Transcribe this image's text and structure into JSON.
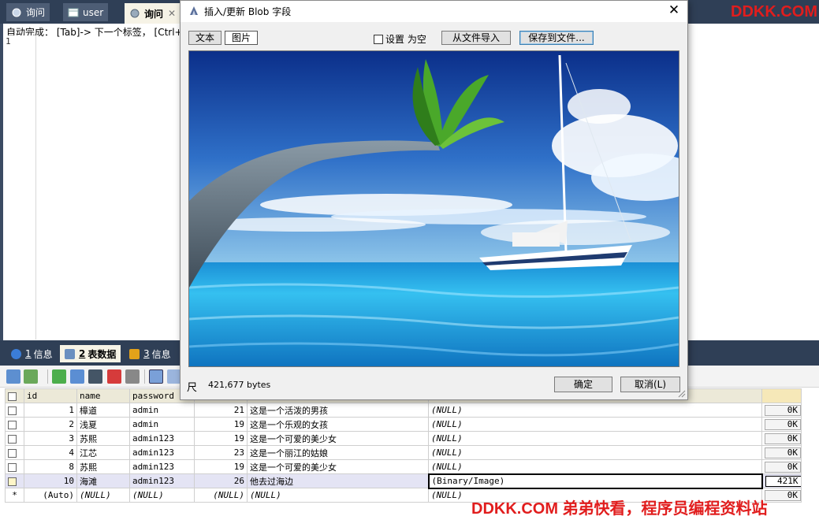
{
  "tabs": [
    {
      "label": "询问",
      "icon": "query-icon"
    },
    {
      "label": "user",
      "icon": "table-icon"
    },
    {
      "label": "询问",
      "icon": "query-icon",
      "close": "✕"
    }
  ],
  "watermark_top": "DDKK.COM",
  "watermark_bottom": "DDKK.COM 弟弟快看，程序员编程资料站",
  "editor": {
    "hint": "自动完成： [Tab]-> 下一个标签， [Ctrl+",
    "line_number": "1"
  },
  "result_tabs": [
    {
      "num": "1",
      "label": "信息"
    },
    {
      "num": "2",
      "label": "表数据"
    },
    {
      "num": "3",
      "label": "信息"
    }
  ],
  "grid": {
    "columns": [
      "id",
      "name",
      "password"
    ],
    "rows": [
      {
        "id": "1",
        "name": "樟道",
        "password": "admin",
        "age": "21",
        "desc": "这是一个活泼的男孩",
        "blob": "(NULL)",
        "size": "0K"
      },
      {
        "id": "2",
        "name": "浅夏",
        "password": "admin",
        "age": "19",
        "desc": "这是一个乐观的女孩",
        "blob": "(NULL)",
        "size": "0K"
      },
      {
        "id": "3",
        "name": "苏熙",
        "password": "admin123",
        "age": "19",
        "desc": "这是一个可爱的美少女",
        "blob": "(NULL)",
        "size": "0K"
      },
      {
        "id": "4",
        "name": "江芯",
        "password": "admin123",
        "age": "23",
        "desc": "这是一个丽江的姑娘",
        "blob": "(NULL)",
        "size": "0K"
      },
      {
        "id": "8",
        "name": "苏熙",
        "password": "admin123",
        "age": "19",
        "desc": "这是一个可爱的美少女",
        "blob": "(NULL)",
        "size": "0K"
      },
      {
        "id": "10",
        "name": "海滩",
        "password": "admin123",
        "age": "26",
        "desc": "他去过海边",
        "blob": "(Binary/Image)",
        "size": "421K"
      }
    ],
    "new_row": {
      "marker": "*",
      "id": "(Auto)",
      "name": "(NULL)",
      "password": "(NULL)",
      "age": "(NULL)",
      "desc": "(NULL)",
      "blob": "(NULL)",
      "size": "0K"
    }
  },
  "dialog": {
    "title": "插入/更新 Blob 字段",
    "close": "✕",
    "tab_text": "文本",
    "tab_image": "图片",
    "fit_label": "设置 为空",
    "import_button": "从文件导入",
    "save_button": "保存到文件...",
    "ruler_icon": "尺",
    "bytes": "421,677 bytes",
    "ok_button": "确定",
    "cancel_button": "取消(L)"
  }
}
